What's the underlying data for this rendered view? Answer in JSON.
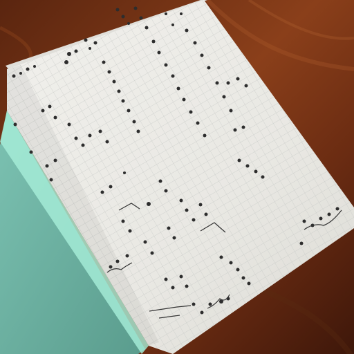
{
  "scene": {
    "description_key": "open-grid-notebook-on-wooden-table",
    "colors": {
      "wood_dark": "#4a1e0c",
      "wood_mid": "#7a3516",
      "wood_light": "#a5532a",
      "paper": "#ecebe6",
      "paper_shadow": "#d9d8d2",
      "grid_line": "#c9cbc8",
      "cover_teal": "#6fb3a4",
      "cover_edge": "#9ee3cf",
      "ink": "#2b2b2b"
    }
  }
}
